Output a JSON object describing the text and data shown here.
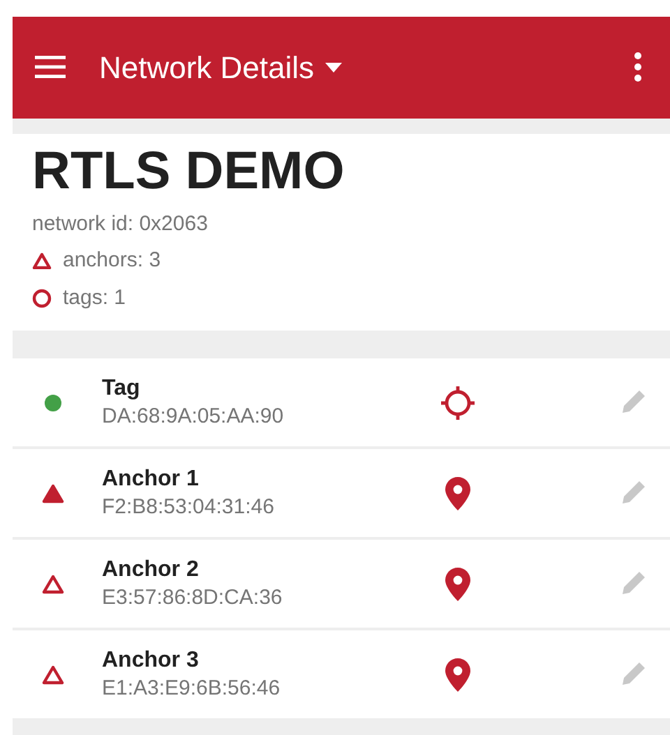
{
  "app_bar": {
    "title": "Network Details"
  },
  "network": {
    "name": "RTLS DEMO",
    "id_line": "network id: 0x2063",
    "anchors_line": "anchors: 3",
    "tags_line": "tags: 1"
  },
  "devices": [
    {
      "kind": "tag",
      "name": "Tag",
      "address": "DA:68:9A:05:AA:90",
      "color": "#43a047"
    },
    {
      "kind": "anchor",
      "name": "Anchor 1",
      "address": "F2:B8:53:04:31:46",
      "color": "#c01f2f",
      "initiator": true
    },
    {
      "kind": "anchor",
      "name": "Anchor 2",
      "address": "E3:57:86:8D:CA:36",
      "color": "#c01f2f",
      "initiator": false
    },
    {
      "kind": "anchor",
      "name": "Anchor 3",
      "address": "E1:A3:E9:6B:56:46",
      "color": "#c01f2f",
      "initiator": false
    }
  ]
}
